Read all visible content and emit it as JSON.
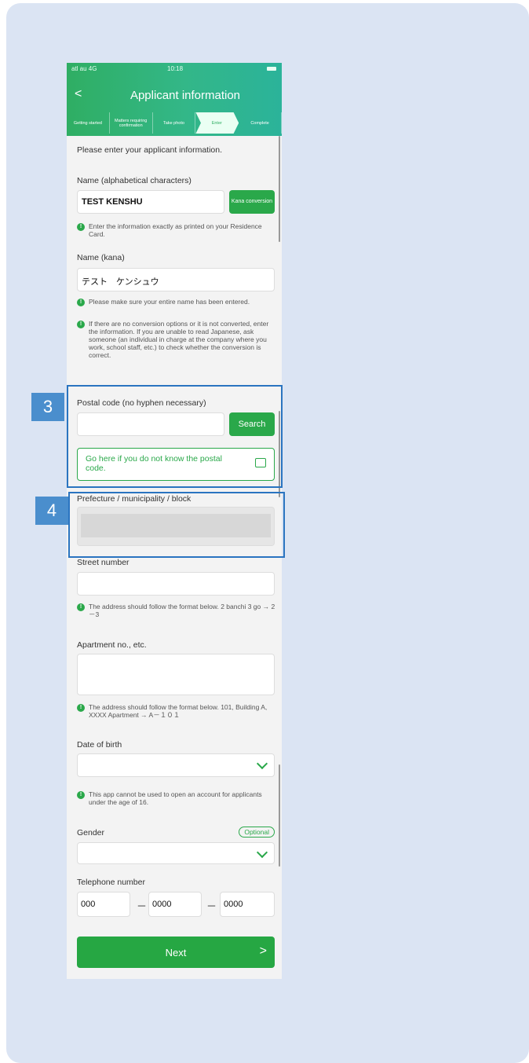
{
  "status_bar": {
    "carrier": "atl au 4G",
    "time": "10:18"
  },
  "header": {
    "back": "<",
    "title": "Applicant information"
  },
  "steps": [
    "Getting started",
    "Matters requiring confirmation",
    "Take photo",
    "Enter",
    "Complete"
  ],
  "intro": "Please enter your applicant information.",
  "name_alpha": {
    "label": "Name (alphabetical characters)",
    "value": "TEST KENSHU",
    "button": "Kana conversion",
    "notice": "Enter the information exactly as printed on your Residence Card."
  },
  "name_kana": {
    "label": "Name (kana)",
    "value": "テスト　ケンシュウ",
    "notice1": "Please make sure your entire name has been entered.",
    "notice2": "If there are no conversion options or it is not converted, enter the information. If you are unable to read Japanese, ask someone (an individual in charge at the company where you work, school staff, etc.) to check whether the conversion is correct."
  },
  "postal": {
    "label": "Postal code (no hyphen necessary)",
    "button": "Search",
    "link": "Go here if you do not know the postal code."
  },
  "prefecture": {
    "label": "Prefecture / municipality / block"
  },
  "street": {
    "label": "Street number",
    "notice": "The address should follow the format below. 2 banchi 3 go → 2－3"
  },
  "apartment": {
    "label": "Apartment no., etc.",
    "notice": "The address should follow the format below. 101, Building A, XXXX Apartment → A－１０１"
  },
  "birth": {
    "label": "Date of birth",
    "notice": "This app cannot be used to open an account for applicants under the age of 16."
  },
  "gender": {
    "label": "Gender",
    "optional": "Optional"
  },
  "telephone": {
    "label": "Telephone number",
    "part1": "000",
    "part2": "0000",
    "part3": "0000",
    "sep": "－"
  },
  "next_button": {
    "label": "Next",
    "arrow": ">"
  },
  "callouts": {
    "three": "3",
    "four": "4"
  },
  "colors": {
    "accent": "#2aa84a",
    "highlight": "#2a74c0"
  }
}
